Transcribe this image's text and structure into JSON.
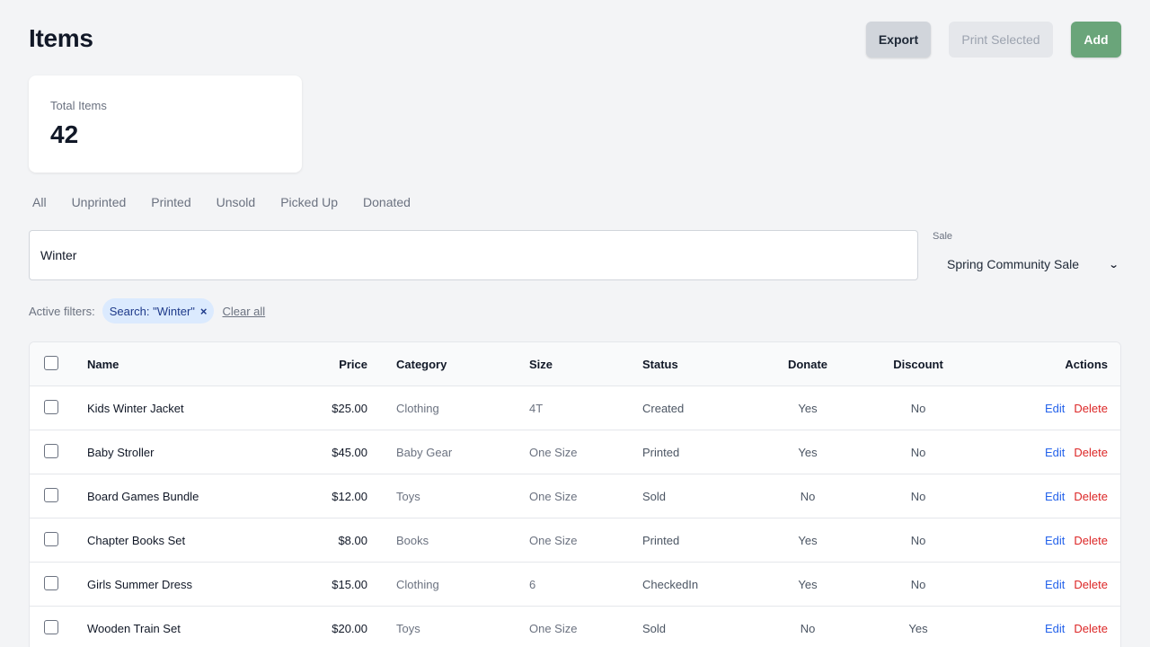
{
  "header": {
    "title": "Items",
    "export_label": "Export",
    "print_label": "Print Selected",
    "add_label": "Add"
  },
  "stats": {
    "label": "Total Items",
    "value": "42"
  },
  "tabs": [
    "All",
    "Unprinted",
    "Printed",
    "Unsold",
    "Picked Up",
    "Donated"
  ],
  "search": {
    "value": "Winter"
  },
  "sale": {
    "label": "Sale",
    "selected": "Spring Community Sale"
  },
  "filters": {
    "label": "Active filters:",
    "chip": "Search: \"Winter\"",
    "chip_remove": "×",
    "clear_all": "Clear all"
  },
  "table": {
    "columns": [
      "Name",
      "Price",
      "Category",
      "Size",
      "Status",
      "Donate",
      "Discount",
      "Actions"
    ],
    "edit_label": "Edit",
    "delete_label": "Delete",
    "rows": [
      {
        "name": "Kids Winter Jacket",
        "price": "$25.00",
        "category": "Clothing",
        "size": "4T",
        "status": "Created",
        "donate": "Yes",
        "discount": "No"
      },
      {
        "name": "Baby Stroller",
        "price": "$45.00",
        "category": "Baby Gear",
        "size": "One Size",
        "status": "Printed",
        "donate": "Yes",
        "discount": "No"
      },
      {
        "name": "Board Games Bundle",
        "price": "$12.00",
        "category": "Toys",
        "size": "One Size",
        "status": "Sold",
        "donate": "No",
        "discount": "No"
      },
      {
        "name": "Chapter Books Set",
        "price": "$8.00",
        "category": "Books",
        "size": "One Size",
        "status": "Printed",
        "donate": "Yes",
        "discount": "No"
      },
      {
        "name": "Girls Summer Dress",
        "price": "$15.00",
        "category": "Clothing",
        "size": "6",
        "status": "CheckedIn",
        "donate": "Yes",
        "discount": "No"
      },
      {
        "name": "Wooden Train Set",
        "price": "$20.00",
        "category": "Toys",
        "size": "One Size",
        "status": "Sold",
        "donate": "No",
        "discount": "Yes"
      }
    ]
  }
}
